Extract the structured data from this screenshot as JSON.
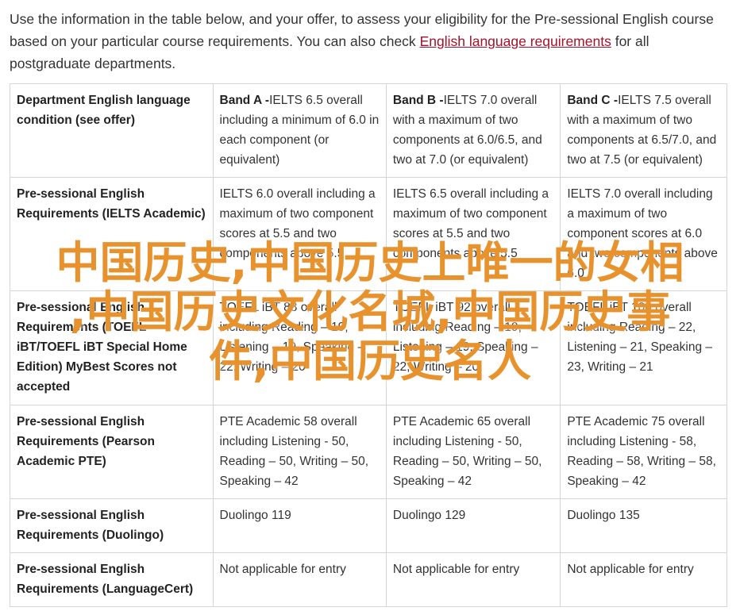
{
  "intro": {
    "text_before": "Use the information in the table below, and your offer, to assess your eligibility for the Pre-sessional English course based on your particular course requirements. You can also check ",
    "link_text": "English language requirements",
    "text_after": " for all postgraduate departments."
  },
  "table": {
    "header": {
      "label": "Department English language condition (see offer)",
      "bands": [
        {
          "name": "Band A -",
          "desc": "IELTS 6.5 overall including a minimum of 6.0 in each component (or equivalent)"
        },
        {
          "name": "Band B -",
          "desc": "IELTS 7.0 overall with a maximum of two components at 6.0/6.5, and two at 7.0 (or equivalent)"
        },
        {
          "name": "Band C -",
          "desc": "IELTS 7.5 overall with a maximum of two components at 6.5/7.0, and two at 7.5 (or equivalent)"
        }
      ]
    },
    "rows": [
      {
        "label": "Pre-sessional English Requirements (IELTS Academic)",
        "values": [
          "IELTS 6.0 overall including a maximum of two component scores at 5.5 and two components above 5.5",
          "IELTS 6.5 overall including a maximum of two component scores at 5.5 and two components above 5.5",
          "IELTS 7.0 overall including a maximum of two component scores at 6.0 and two components above 6.0"
        ]
      },
      {
        "label": "Pre-sessional English Requirements (TOEFL iBT/TOEFL iBT Special Home Edition) MyBest Scores not accepted",
        "values": [
          "TOEFL iBT 88 overall including Reading – 19, Listening – 19, Speaking – 22, Writing – 20",
          "TOEFL iBT 92 overall including Reading – 19, Listening – 19, Speaking – 22, Writing – 20",
          "TOEFL iBT 100 overall including Reading – 22, Listening – 21, Speaking – 23, Writing – 21"
        ]
      },
      {
        "label": "Pre-sessional English Requirements (Pearson Academic PTE)",
        "values": [
          "PTE Academic 58 overall including Listening - 50, Reading – 50, Writing – 50, Speaking – 42",
          "PTE Academic 65 overall including Listening - 50, Reading – 50, Writing – 50, Speaking – 42",
          "PTE Academic 75 overall including Listening - 58, Reading – 58, Writing – 58, Speaking – 42"
        ]
      },
      {
        "label": "Pre-sessional English Requirements (Duolingo)",
        "values": [
          "Duolingo 119",
          "Duolingo 129",
          "Duolingo 135"
        ]
      },
      {
        "label": "Pre-sessional English Requirements (LanguageCert)",
        "values": [
          "Not applicable for entry",
          "Not applicable for entry",
          "Not applicable for entry"
        ]
      }
    ]
  },
  "overlay": {
    "line1": "中国历史,中国历史上唯一的女相",
    "line2": ",中国历史文化名城,中国历史事",
    "line3": "件,中国历史名人"
  },
  "colors": {
    "link": "#a3122b",
    "overlay": "#e8922e",
    "border": "#d5d5d5",
    "text": "#333333"
  }
}
